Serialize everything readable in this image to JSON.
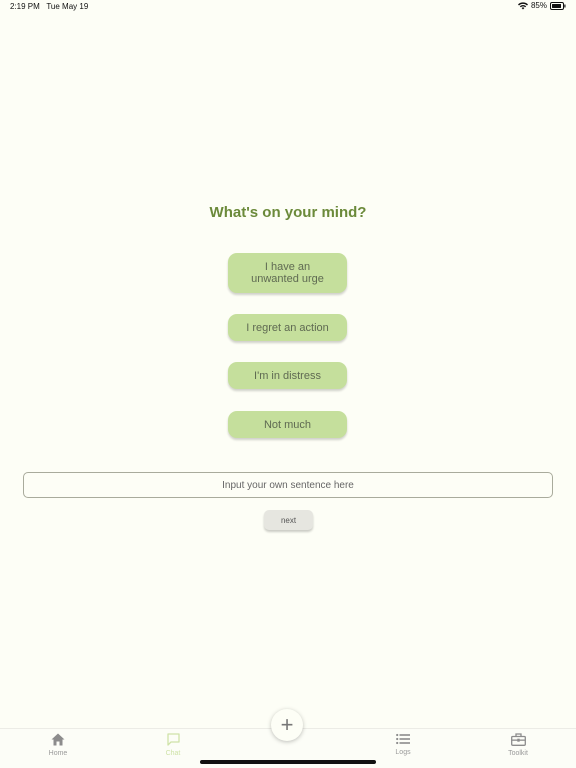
{
  "status_bar": {
    "time": "2:19 PM",
    "date": "Tue May 19",
    "battery": "85%"
  },
  "prompt": {
    "title": "What's on your mind?"
  },
  "options": [
    {
      "label": "I have an unwanted urge"
    },
    {
      "label": "I regret an action"
    },
    {
      "label": "I'm in distress"
    },
    {
      "label": "Not much"
    }
  ],
  "sentence_input": {
    "placeholder": "Input your own sentence here",
    "value": ""
  },
  "next_button": {
    "label": "next"
  },
  "tab_bar": {
    "tabs": [
      {
        "label": "Home",
        "icon": "home-icon"
      },
      {
        "label": "Chat",
        "icon": "chat-icon",
        "active": true
      },
      {
        "label": "Logs",
        "icon": "list-icon"
      },
      {
        "label": "Toolkit",
        "icon": "toolbox-icon"
      }
    ],
    "add_button_label": "+"
  },
  "colors": {
    "background": "#fdfef6",
    "accent": "#c5df9c",
    "title": "#6b8a3a",
    "active_tab": "#cfe3a8"
  }
}
